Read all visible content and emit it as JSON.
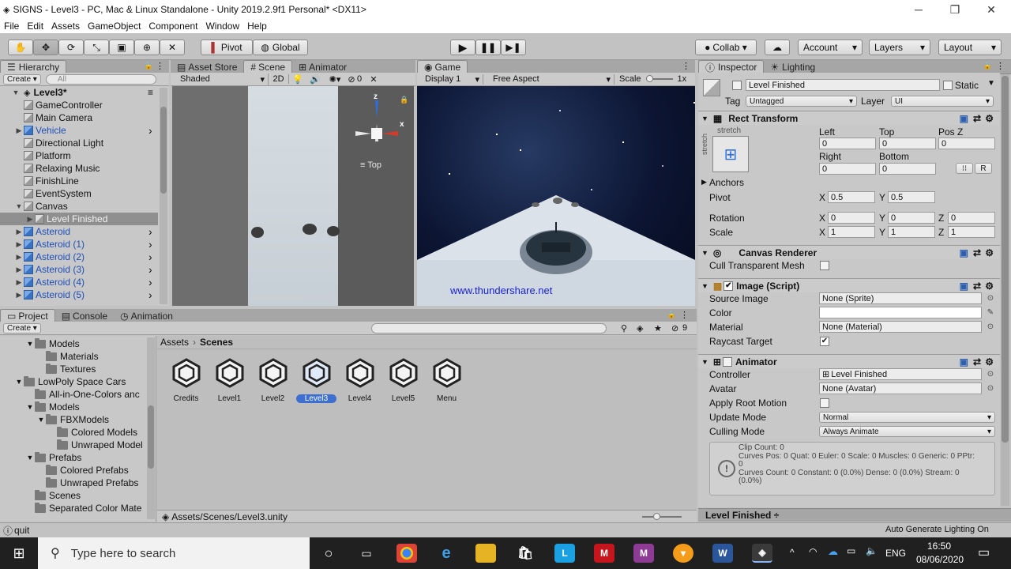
{
  "window": {
    "title": "SIGNS - Level3 - PC, Mac & Linux Standalone - Unity 2019.2.9f1 Personal* <DX11>",
    "minimize": "─",
    "maximize": "❐",
    "close": "✕"
  },
  "menu": [
    "File",
    "Edit",
    "Assets",
    "GameObject",
    "Component",
    "Window",
    "Help"
  ],
  "toolbar": {
    "pivot": "Pivot",
    "global": "Global",
    "collab": "Collab ▾",
    "account": "Account",
    "layers": "Layers",
    "layout": "Layout",
    "tools": [
      "hand-tool-icon",
      "move-tool-icon",
      "rotate-tool-icon",
      "scale-tool-icon",
      "rect-tool-icon",
      "transform-tool-icon",
      "custom-tool-icon"
    ]
  },
  "hierarchy": {
    "tab": "Hierarchy",
    "create": "Create ▾",
    "search": "All",
    "scene": "Level3*",
    "items": [
      {
        "label": "GameController",
        "indent": 1,
        "blue": false,
        "arrow": ""
      },
      {
        "label": "Main Camera",
        "indent": 1,
        "blue": false,
        "arrow": ""
      },
      {
        "label": "Vehicle",
        "indent": 1,
        "blue": true,
        "arrow": "▶"
      },
      {
        "label": "Directional Light",
        "indent": 1,
        "blue": false,
        "arrow": ""
      },
      {
        "label": "Platform",
        "indent": 1,
        "blue": false,
        "arrow": ""
      },
      {
        "label": "Relaxing Music",
        "indent": 1,
        "blue": false,
        "arrow": ""
      },
      {
        "label": "FinishLine",
        "indent": 1,
        "blue": false,
        "arrow": ""
      },
      {
        "label": "EventSystem",
        "indent": 1,
        "blue": false,
        "arrow": ""
      },
      {
        "label": "Canvas",
        "indent": 1,
        "blue": false,
        "arrow": "▼"
      },
      {
        "label": "Level Finished",
        "indent": 2,
        "blue": false,
        "arrow": "▶",
        "selected": true
      },
      {
        "label": "Asteroid",
        "indent": 1,
        "blue": true,
        "arrow": "▶"
      },
      {
        "label": "Asteroid (1)",
        "indent": 1,
        "blue": true,
        "arrow": "▶"
      },
      {
        "label": "Asteroid (2)",
        "indent": 1,
        "blue": true,
        "arrow": "▶"
      },
      {
        "label": "Asteroid (3)",
        "indent": 1,
        "blue": true,
        "arrow": "▶"
      },
      {
        "label": "Asteroid (4)",
        "indent": 1,
        "blue": true,
        "arrow": "▶"
      },
      {
        "label": "Asteroid (5)",
        "indent": 1,
        "blue": true,
        "arrow": "▶"
      }
    ]
  },
  "scene_panel": {
    "tabs": [
      "Asset Store",
      "Scene",
      "Animator"
    ],
    "shading": "Shaded",
    "mode2d": "2D",
    "gizmo_count": "0",
    "view_label": "Top",
    "axis_z": "z",
    "axis_x": "x"
  },
  "game_panel": {
    "tab": "Game",
    "display": "Display 1",
    "aspect": "Free Aspect",
    "scale_label": "Scale",
    "scale_value": "1x",
    "watermark": "www.thundershare.net"
  },
  "project": {
    "tabs": [
      "Project",
      "Console",
      "Animation"
    ],
    "create": "Create ▾",
    "hidden_count": "9",
    "breadcrumb": [
      "Assets",
      "Scenes"
    ],
    "tree": [
      {
        "label": "Models",
        "indent": 1,
        "arrow": "▼"
      },
      {
        "label": "Materials",
        "indent": 2,
        "arrow": ""
      },
      {
        "label": "Textures",
        "indent": 2,
        "arrow": ""
      },
      {
        "label": "LowPoly Space Cars",
        "indent": 0,
        "arrow": "▼"
      },
      {
        "label": "All-in-One-Colors anc",
        "indent": 1,
        "arrow": ""
      },
      {
        "label": "Models",
        "indent": 1,
        "arrow": "▼"
      },
      {
        "label": "FBXModels",
        "indent": 2,
        "arrow": "▼"
      },
      {
        "label": "Colored Models",
        "indent": 3,
        "arrow": ""
      },
      {
        "label": "Unwraped Model",
        "indent": 3,
        "arrow": ""
      },
      {
        "label": "Prefabs",
        "indent": 1,
        "arrow": "▼"
      },
      {
        "label": "Colored Prefabs",
        "indent": 2,
        "arrow": ""
      },
      {
        "label": "Unwraped Prefabs",
        "indent": 2,
        "arrow": ""
      },
      {
        "label": "Scenes",
        "indent": 1,
        "arrow": ""
      },
      {
        "label": "Separated Color Mate",
        "indent": 1,
        "arrow": ""
      }
    ],
    "scenes": [
      "Credits",
      "Level1",
      "Level2",
      "Level3",
      "Level4",
      "Level5",
      "Menu"
    ],
    "selected_scene": "Level3",
    "path": "Assets/Scenes/Level3.unity"
  },
  "inspector": {
    "tabs": [
      "Inspector",
      "Lighting"
    ],
    "object_name": "Level Finished",
    "static_label": "Static",
    "tag_label": "Tag",
    "tag_value": "Untagged",
    "layer_label": "Layer",
    "layer_value": "UI",
    "rect": {
      "title": "Rect Transform",
      "stretch": "stretch",
      "left_label": "Left",
      "top_label": "Top",
      "posz_label": "Pos Z",
      "left": "0",
      "top": "0",
      "posz": "0",
      "right_label": "Right",
      "bottom_label": "Bottom",
      "right": "0",
      "bottom": "0",
      "r_button": "R",
      "anchors": "Anchors",
      "pivot_label": "Pivot",
      "pivot_x": "0.5",
      "pivot_y": "0.5",
      "rotation_label": "Rotation",
      "rot_x": "0",
      "rot_y": "0",
      "rot_z": "0",
      "scale_label": "Scale",
      "scale_x": "1",
      "scale_y": "1",
      "scale_z": "1",
      "x": "X",
      "y": "Y",
      "z": "Z"
    },
    "canvas_renderer": {
      "title": "Canvas Renderer",
      "cull": "Cull Transparent Mesh"
    },
    "image": {
      "title": "Image (Script)",
      "source_label": "Source Image",
      "source": "None (Sprite)",
      "color_label": "Color",
      "material_label": "Material",
      "material": "None (Material)",
      "raycast_label": "Raycast Target"
    },
    "animator": {
      "title": "Animator",
      "controller_label": "Controller",
      "controller": "Level Finished",
      "avatar_label": "Avatar",
      "avatar": "None (Avatar)",
      "root_motion_label": "Apply Root Motion",
      "update_label": "Update Mode",
      "update": "Normal",
      "culling_label": "Culling Mode",
      "culling": "Always Animate",
      "info_lines": [
        "Clip Count: 0",
        "Curves Pos: 0 Quat: 0 Euler: 0 Scale: 0 Muscles: 0 Generic: 0 PPtr:",
        "0",
        "Curves Count: 0 Constant: 0 (0.0%) Dense: 0 (0.0%) Stream: 0",
        "(0.0%)"
      ]
    },
    "footer": "Level Finished ÷"
  },
  "status": {
    "message": "quit",
    "right": "Auto Generate Lighting On"
  },
  "taskbar": {
    "search": "Type here to search",
    "lang": "ENG",
    "time": "16:50",
    "date": "08/06/2020"
  }
}
